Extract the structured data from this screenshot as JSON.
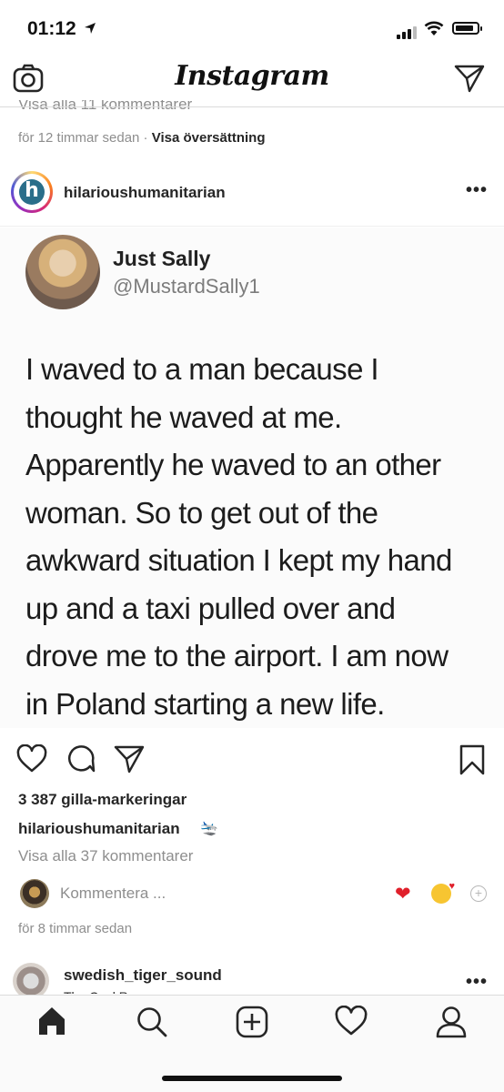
{
  "status_bar": {
    "time": "01:12"
  },
  "header": {
    "brand": "Instagram"
  },
  "previous_post": {
    "view_comments": "Visa alla 11 kommentarer",
    "time_ago": "för 12 timmar sedan",
    "separator": " · ",
    "translate": "Visa översättning"
  },
  "post": {
    "username": "hilarioushumanitarian",
    "avatar_letter": "h",
    "more": "•••",
    "tweet": {
      "name": "Just Sally",
      "handle": "@MustardSally1",
      "lines": [
        "I waved to a man because I",
        "thought he waved at me.",
        "Apparently he waved to an other",
        "woman. So to get out of the",
        "awkward situation I kept my hand",
        "up and a taxi pulled over and",
        "drove me to the airport. I am now",
        "in Poland starting a new life."
      ]
    },
    "likes": "3 387 gilla-markeringar",
    "caption_user": "hilarioushumanitarian",
    "caption_emoji": "🛬",
    "view_comments": "Visa alla 37 kommentarer",
    "comment_placeholder": "Kommentera ...",
    "time_ago": "för 8 timmar sedan"
  },
  "next_post": {
    "username": "swedish_tiger_sound",
    "subtitle": "The Oval Room",
    "more": "•••"
  },
  "icons": {
    "camera": "camera-icon",
    "direct": "direct-message-icon",
    "like": "heart-icon",
    "comment": "comment-icon",
    "share": "share-icon",
    "save": "bookmark-icon",
    "home": "home-icon",
    "search": "search-icon",
    "add": "add-post-icon",
    "activity": "activity-heart-icon",
    "profile": "profile-icon"
  }
}
